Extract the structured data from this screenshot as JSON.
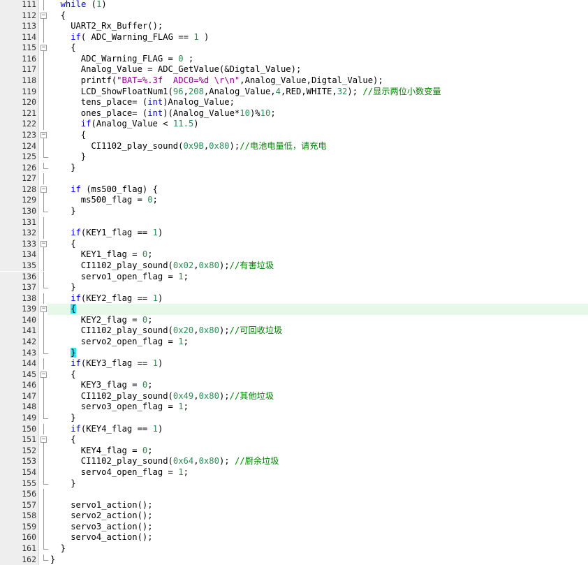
{
  "editor": {
    "colors": {
      "keyword": "#0000ff",
      "number": "#2e8b57",
      "string": "#8b008b",
      "comment": "#008000",
      "text": "#000000",
      "gutter_bg": "#eeeeee",
      "current_line_bg": "#e8f8e8",
      "brace_match": "#33e5f0"
    },
    "current_line": 139,
    "lines": [
      {
        "n": "111",
        "indent": 1,
        "fold": "line",
        "tokens": [
          [
            "kw",
            "while"
          ],
          [
            "plain",
            " ("
          ],
          [
            "num",
            "1"
          ],
          [
            "plain",
            ")"
          ]
        ]
      },
      {
        "n": "112",
        "indent": 1,
        "fold": "open",
        "tokens": [
          [
            "plain",
            "{"
          ]
        ]
      },
      {
        "n": "113",
        "indent": 2,
        "fold": "line",
        "tokens": [
          [
            "plain",
            "UART2_Rx_Buffer();"
          ]
        ]
      },
      {
        "n": "114",
        "indent": 2,
        "fold": "line",
        "tokens": [
          [
            "kw",
            "if"
          ],
          [
            "plain",
            "( ADC_Warning_FLAG == "
          ],
          [
            "num",
            "1"
          ],
          [
            "plain",
            " )"
          ]
        ]
      },
      {
        "n": "115",
        "indent": 2,
        "fold": "open",
        "tokens": [
          [
            "plain",
            "{"
          ]
        ]
      },
      {
        "n": "116",
        "indent": 3,
        "fold": "line",
        "tokens": [
          [
            "plain",
            "ADC_Warning_FLAG = "
          ],
          [
            "num",
            "0"
          ],
          [
            "plain",
            " ;"
          ]
        ]
      },
      {
        "n": "117",
        "indent": 3,
        "fold": "line",
        "tokens": [
          [
            "plain",
            "Analog_Value = ADC_GetValue(&Digtal_Value);"
          ]
        ]
      },
      {
        "n": "118",
        "indent": 3,
        "fold": "line",
        "tokens": [
          [
            "plain",
            "printf("
          ],
          [
            "str",
            "\"BAT=%.3f  ADC0=%d \\r\\n\""
          ],
          [
            "plain",
            ",Analog_Value,Digtal_Value);"
          ]
        ]
      },
      {
        "n": "119",
        "indent": 3,
        "fold": "line",
        "tokens": [
          [
            "plain",
            "LCD_ShowFloatNum1("
          ],
          [
            "num",
            "96"
          ],
          [
            "plain",
            ","
          ],
          [
            "num",
            "208"
          ],
          [
            "plain",
            ",Analog_Value,"
          ],
          [
            "num",
            "4"
          ],
          [
            "plain",
            ",RED,WHITE,"
          ],
          [
            "num",
            "32"
          ],
          [
            "plain",
            "); "
          ],
          [
            "com",
            "//显示两位小数变量"
          ]
        ]
      },
      {
        "n": "120",
        "indent": 3,
        "fold": "line",
        "tokens": [
          [
            "plain",
            "tens_place= ("
          ],
          [
            "kw",
            "int"
          ],
          [
            "plain",
            ")Analog_Value;"
          ]
        ]
      },
      {
        "n": "121",
        "indent": 3,
        "fold": "line",
        "tokens": [
          [
            "plain",
            "ones_place= ("
          ],
          [
            "kw",
            "int"
          ],
          [
            "plain",
            ")(Analog_Value*"
          ],
          [
            "num",
            "10"
          ],
          [
            "plain",
            ")%"
          ],
          [
            "num",
            "10"
          ],
          [
            "plain",
            ";"
          ]
        ]
      },
      {
        "n": "122",
        "indent": 3,
        "fold": "line",
        "tokens": [
          [
            "kw",
            "if"
          ],
          [
            "plain",
            "(Analog_Value < "
          ],
          [
            "num",
            "11.5"
          ],
          [
            "plain",
            ")"
          ]
        ]
      },
      {
        "n": "123",
        "indent": 3,
        "fold": "open",
        "tokens": [
          [
            "plain",
            "{"
          ]
        ]
      },
      {
        "n": "124",
        "indent": 4,
        "fold": "line",
        "tokens": [
          [
            "plain",
            "CI1102_play_sound("
          ],
          [
            "num",
            "0x9B"
          ],
          [
            "plain",
            ","
          ],
          [
            "num",
            "0x80"
          ],
          [
            "plain",
            ");"
          ],
          [
            "com",
            "//电池电量低，请充电"
          ]
        ]
      },
      {
        "n": "125",
        "indent": 3,
        "fold": "end",
        "tokens": [
          [
            "plain",
            "}"
          ]
        ]
      },
      {
        "n": "126",
        "indent": 2,
        "fold": "end",
        "tokens": [
          [
            "plain",
            "}"
          ]
        ]
      },
      {
        "n": "127",
        "indent": 0,
        "fold": "line",
        "tokens": []
      },
      {
        "n": "128",
        "indent": 2,
        "fold": "open",
        "tokens": [
          [
            "kw",
            "if"
          ],
          [
            "plain",
            " (ms500_flag) {"
          ]
        ]
      },
      {
        "n": "129",
        "indent": 3,
        "fold": "line",
        "tokens": [
          [
            "plain",
            "ms500_flag = "
          ],
          [
            "num",
            "0"
          ],
          [
            "plain",
            ";"
          ]
        ]
      },
      {
        "n": "130",
        "indent": 2,
        "fold": "end",
        "tokens": [
          [
            "plain",
            "}"
          ]
        ]
      },
      {
        "n": "131",
        "indent": 0,
        "fold": "line",
        "tokens": []
      },
      {
        "n": "132",
        "indent": 2,
        "fold": "line",
        "tokens": [
          [
            "kw",
            "if"
          ],
          [
            "plain",
            "(KEY1_flag == "
          ],
          [
            "num",
            "1"
          ],
          [
            "plain",
            ")"
          ]
        ]
      },
      {
        "n": "133",
        "indent": 2,
        "fold": "open",
        "tokens": [
          [
            "plain",
            "{"
          ]
        ]
      },
      {
        "n": "134",
        "indent": 3,
        "fold": "line",
        "tokens": [
          [
            "plain",
            "KEY1_flag = "
          ],
          [
            "num",
            "0"
          ],
          [
            "plain",
            ";"
          ]
        ]
      },
      {
        "n": "135",
        "indent": 3,
        "fold": "line",
        "tokens": [
          [
            "plain",
            "CI1102_play_sound("
          ],
          [
            "num",
            "0x02"
          ],
          [
            "plain",
            ","
          ],
          [
            "num",
            "0x80"
          ],
          [
            "plain",
            ");"
          ],
          [
            "com",
            "//有害垃圾"
          ]
        ]
      },
      {
        "n": "136",
        "indent": 3,
        "fold": "line",
        "tokens": [
          [
            "plain",
            "servo1_open_flag = "
          ],
          [
            "num",
            "1"
          ],
          [
            "plain",
            ";"
          ]
        ]
      },
      {
        "n": "137",
        "indent": 2,
        "fold": "end",
        "tokens": [
          [
            "plain",
            "}"
          ]
        ]
      },
      {
        "n": "138",
        "indent": 2,
        "fold": "line",
        "tokens": [
          [
            "kw",
            "if"
          ],
          [
            "plain",
            "(KEY2_flag == "
          ],
          [
            "num",
            "1"
          ],
          [
            "plain",
            ")"
          ]
        ]
      },
      {
        "n": "139",
        "indent": 2,
        "fold": "open",
        "tokens": [
          [
            "hl",
            "{"
          ]
        ]
      },
      {
        "n": "140",
        "indent": 3,
        "fold": "line",
        "tokens": [
          [
            "plain",
            "KEY2_flag = "
          ],
          [
            "num",
            "0"
          ],
          [
            "plain",
            ";"
          ]
        ]
      },
      {
        "n": "141",
        "indent": 3,
        "fold": "line",
        "tokens": [
          [
            "plain",
            "CI1102_play_sound("
          ],
          [
            "num",
            "0x20"
          ],
          [
            "plain",
            ","
          ],
          [
            "num",
            "0x80"
          ],
          [
            "plain",
            ");"
          ],
          [
            "com",
            "//可回收垃圾"
          ]
        ]
      },
      {
        "n": "142",
        "indent": 3,
        "fold": "line",
        "tokens": [
          [
            "plain",
            "servo2_open_flag = "
          ],
          [
            "num",
            "1"
          ],
          [
            "plain",
            ";"
          ]
        ]
      },
      {
        "n": "143",
        "indent": 2,
        "fold": "end",
        "tokens": [
          [
            "hl",
            "}"
          ]
        ]
      },
      {
        "n": "144",
        "indent": 2,
        "fold": "line",
        "tokens": [
          [
            "kw",
            "if"
          ],
          [
            "plain",
            "(KEY3_flag == "
          ],
          [
            "num",
            "1"
          ],
          [
            "plain",
            ")"
          ]
        ]
      },
      {
        "n": "145",
        "indent": 2,
        "fold": "open",
        "tokens": [
          [
            "plain",
            "{"
          ]
        ]
      },
      {
        "n": "146",
        "indent": 3,
        "fold": "line",
        "tokens": [
          [
            "plain",
            "KEY3_flag = "
          ],
          [
            "num",
            "0"
          ],
          [
            "plain",
            ";"
          ]
        ]
      },
      {
        "n": "147",
        "indent": 3,
        "fold": "line",
        "tokens": [
          [
            "plain",
            "CI1102_play_sound("
          ],
          [
            "num",
            "0x49"
          ],
          [
            "plain",
            ","
          ],
          [
            "num",
            "0x80"
          ],
          [
            "plain",
            ");"
          ],
          [
            "com",
            "//其他垃圾"
          ]
        ]
      },
      {
        "n": "148",
        "indent": 3,
        "fold": "line",
        "tokens": [
          [
            "plain",
            "servo3_open_flag = "
          ],
          [
            "num",
            "1"
          ],
          [
            "plain",
            ";"
          ]
        ]
      },
      {
        "n": "149",
        "indent": 2,
        "fold": "end",
        "tokens": [
          [
            "plain",
            "}"
          ]
        ]
      },
      {
        "n": "150",
        "indent": 2,
        "fold": "line",
        "tokens": [
          [
            "kw",
            "if"
          ],
          [
            "plain",
            "(KEY4_flag == "
          ],
          [
            "num",
            "1"
          ],
          [
            "plain",
            ")"
          ]
        ]
      },
      {
        "n": "151",
        "indent": 2,
        "fold": "open",
        "tokens": [
          [
            "plain",
            "{"
          ]
        ]
      },
      {
        "n": "152",
        "indent": 3,
        "fold": "line",
        "tokens": [
          [
            "plain",
            "KEY4_flag = "
          ],
          [
            "num",
            "0"
          ],
          [
            "plain",
            ";"
          ]
        ]
      },
      {
        "n": "153",
        "indent": 3,
        "fold": "line",
        "tokens": [
          [
            "plain",
            "CI1102_play_sound("
          ],
          [
            "num",
            "0x64"
          ],
          [
            "plain",
            ","
          ],
          [
            "num",
            "0x80"
          ],
          [
            "plain",
            "); "
          ],
          [
            "com",
            "//厨余垃圾"
          ]
        ]
      },
      {
        "n": "154",
        "indent": 3,
        "fold": "line",
        "tokens": [
          [
            "plain",
            "servo4_open_flag = "
          ],
          [
            "num",
            "1"
          ],
          [
            "plain",
            ";"
          ]
        ]
      },
      {
        "n": "155",
        "indent": 2,
        "fold": "end",
        "tokens": [
          [
            "plain",
            "}"
          ]
        ]
      },
      {
        "n": "156",
        "indent": 0,
        "fold": "line",
        "tokens": []
      },
      {
        "n": "157",
        "indent": 2,
        "fold": "line",
        "tokens": [
          [
            "plain",
            "servo1_action();"
          ]
        ]
      },
      {
        "n": "158",
        "indent": 2,
        "fold": "line",
        "tokens": [
          [
            "plain",
            "servo2_action();"
          ]
        ]
      },
      {
        "n": "159",
        "indent": 2,
        "fold": "line",
        "tokens": [
          [
            "plain",
            "servo3_action();"
          ]
        ]
      },
      {
        "n": "160",
        "indent": 2,
        "fold": "line",
        "tokens": [
          [
            "plain",
            "servo4_action();"
          ]
        ]
      },
      {
        "n": "161",
        "indent": 1,
        "fold": "end",
        "tokens": [
          [
            "plain",
            "}"
          ]
        ]
      },
      {
        "n": "162",
        "indent": 0,
        "fold": "end",
        "tokens": [
          [
            "plain",
            "}"
          ]
        ]
      }
    ]
  }
}
